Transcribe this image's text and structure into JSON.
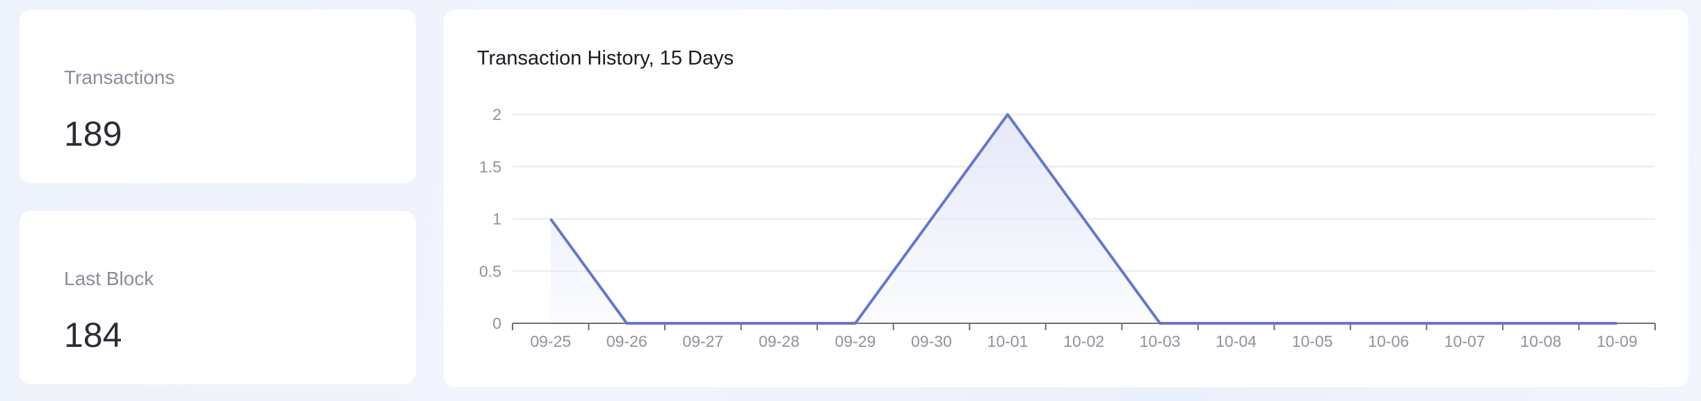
{
  "stats": {
    "transactions": {
      "label": "Transactions",
      "value": "189"
    },
    "last_block": {
      "label": "Last Block",
      "value": "184"
    }
  },
  "chart": {
    "title": "Transaction History, 15 Days"
  },
  "colors": {
    "line": "#6577c9",
    "area_top": "#e3e8f8",
    "grid": "#e7e9ef",
    "axis": "#6b6e78"
  },
  "chart_data": {
    "type": "area",
    "title": "Transaction History, 15 Days",
    "xlabel": "",
    "ylabel": "",
    "categories": [
      "09-25",
      "09-26",
      "09-27",
      "09-28",
      "09-29",
      "09-30",
      "10-01",
      "10-02",
      "10-03",
      "10-04",
      "10-05",
      "10-06",
      "10-07",
      "10-08",
      "10-09"
    ],
    "series": [
      {
        "values": [
          1,
          0,
          0,
          0,
          0,
          1,
          2,
          1,
          0,
          0,
          0,
          0,
          0,
          0,
          0
        ]
      }
    ],
    "yticks": [
      "0",
      "0.5",
      "1",
      "1.5",
      "2"
    ],
    "ylim": [
      0,
      2
    ],
    "grid": true,
    "legend": "none"
  }
}
